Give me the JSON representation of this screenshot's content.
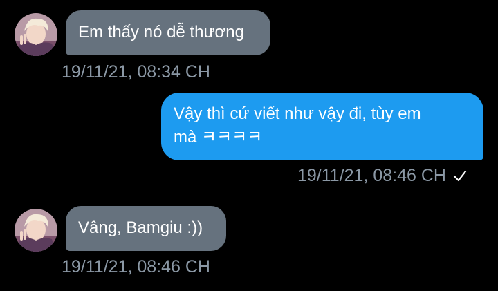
{
  "messages": [
    {
      "direction": "received",
      "text": "Em thấy nó dễ thương",
      "time": "19/11/21, 08:34 CH"
    },
    {
      "direction": "sent",
      "text_line1": "Vậy thì cứ viết như vậy đi, tùy em",
      "text_line2": "mà ㅋㅋㅋㅋ",
      "time": "19/11/21, 08:46 CH",
      "status_icon": "checkmark-icon"
    },
    {
      "direction": "received",
      "text": "Vâng, Bamgiu :))",
      "time": "19/11/21, 08:46 CH"
    }
  ],
  "colors": {
    "background": "#000000",
    "received_bubble": "#66727e",
    "sent_bubble": "#1d9bf0",
    "timestamp": "#8b98a5",
    "text": "#ffffff"
  }
}
